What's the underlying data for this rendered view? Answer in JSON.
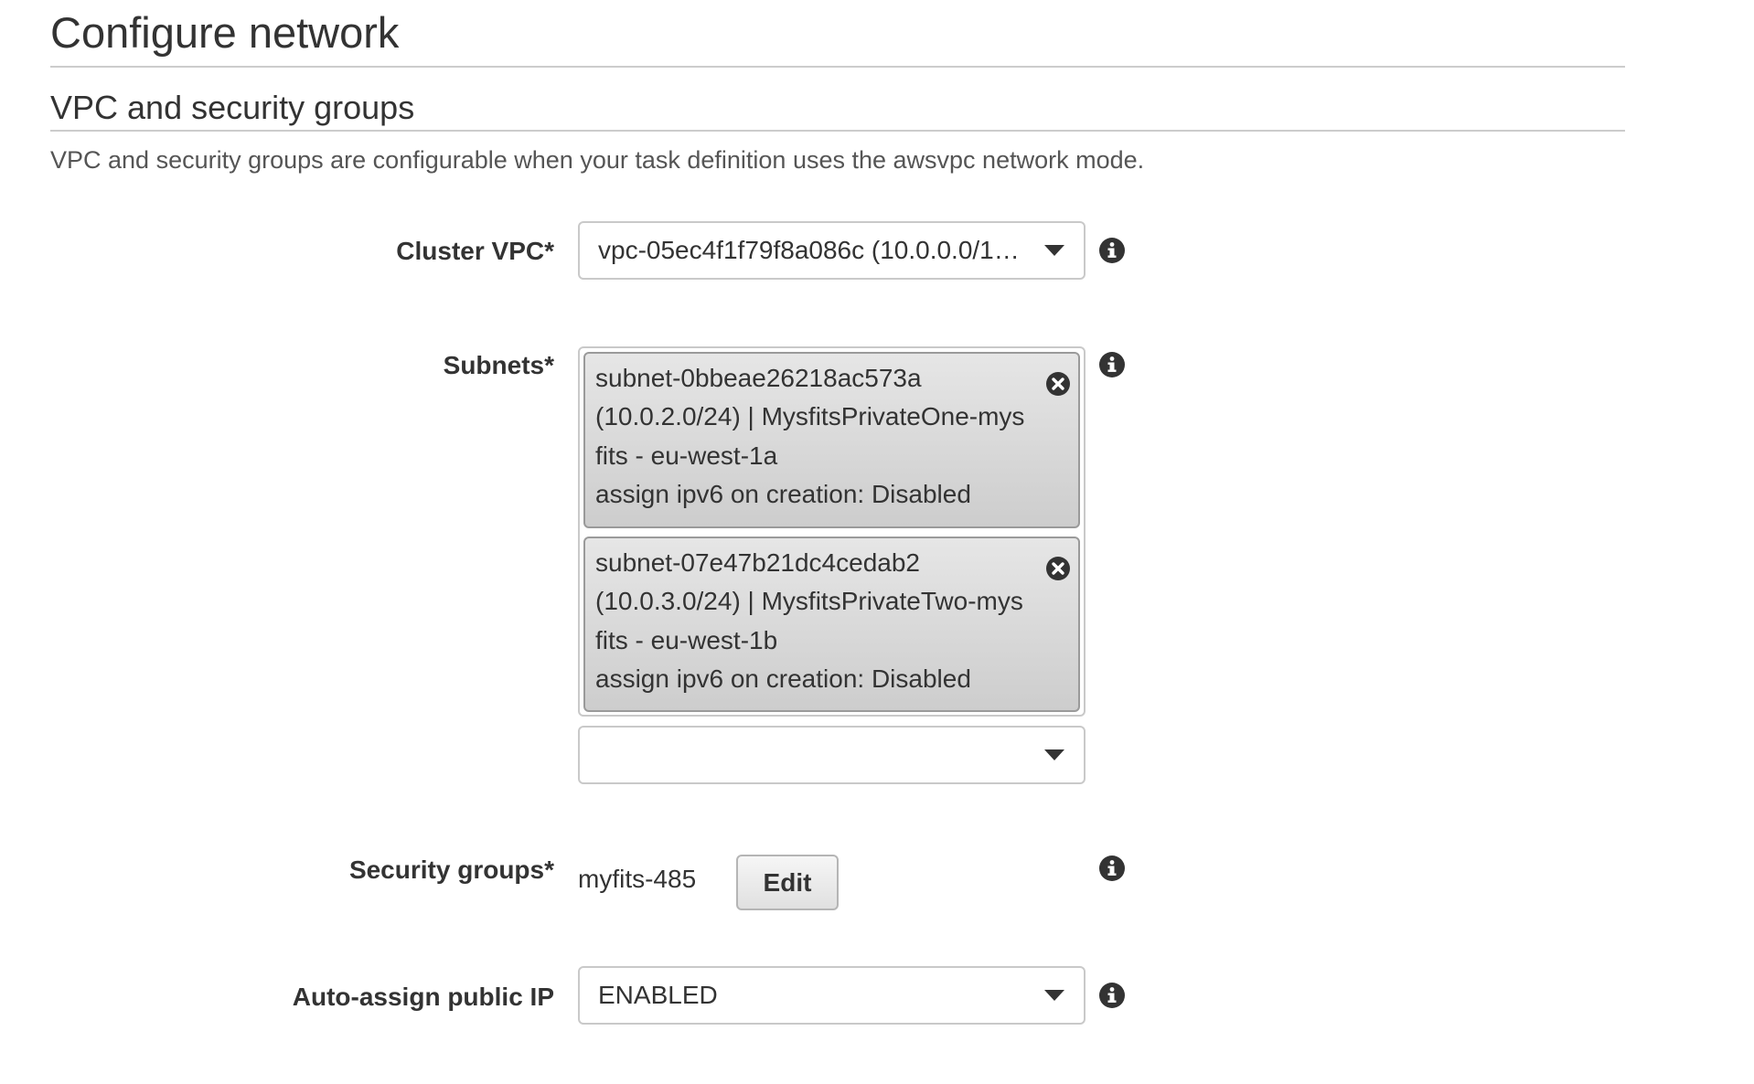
{
  "page": {
    "title": "Configure network"
  },
  "section": {
    "title": "VPC and security groups",
    "description": "VPC and security groups are configurable when your task definition uses the awsvpc network mode."
  },
  "cluster_vpc": {
    "label": "Cluster VPC*",
    "value": "vpc-05ec4f1f79f8a086c (10.0.0.0/1…",
    "icon": "chevron-down-icon",
    "info_icon": "info-icon"
  },
  "subnets": {
    "label": "Subnets*",
    "info_icon": "info-icon",
    "selected": [
      {
        "lines": [
          "subnet-0bbeae26218ac573a",
          "(10.0.2.0/24) | MysfitsPrivateOne-mys",
          "fits - eu-west-1a",
          "assign ipv6 on creation: Disabled"
        ],
        "remove_icon": "close-circle-icon"
      },
      {
        "lines": [
          "subnet-07e47b21dc4cedab2",
          "(10.0.3.0/24) | MysfitsPrivateTwo-mys",
          "fits - eu-west-1b",
          "assign ipv6 on creation: Disabled"
        ],
        "remove_icon": "close-circle-icon"
      }
    ],
    "picker_value": ""
  },
  "security_groups": {
    "label": "Security groups*",
    "value": "myfits-485",
    "edit_label": "Edit",
    "info_icon": "info-icon"
  },
  "auto_assign_ip": {
    "label": "Auto-assign public IP",
    "value": "ENABLED",
    "info_icon": "info-icon"
  },
  "colors": {
    "text": "#444444",
    "border": "#c9c9c9",
    "tag_background": "#d9d9d9",
    "icon": "#333333"
  }
}
